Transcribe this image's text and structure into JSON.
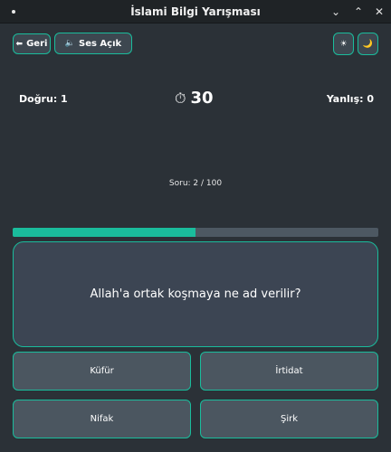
{
  "window": {
    "title": "İslami Bilgi Yarışması",
    "minimize_glyph": "⌄",
    "maximize_glyph": "⌃",
    "close_glyph": "✕"
  },
  "toolbar": {
    "back_icon": "⬅",
    "back_label": "Geri",
    "sound_icon": "🔈",
    "sound_label": "Ses Açık",
    "light_theme_icon": "☀",
    "dark_theme_icon": "🌙"
  },
  "stats": {
    "correct_label": "Doğru: 1",
    "wrong_label": "Yanlış: 0"
  },
  "timer": {
    "icon": "⏱",
    "seconds": "30"
  },
  "question_counter": "Soru: 2 / 100",
  "progress": {
    "fraction": 0.5
  },
  "question": {
    "text": "Allah'a ortak koşmaya ne ad verilir?"
  },
  "answers": [
    {
      "label": "Küfür"
    },
    {
      "label": "İrtidat"
    },
    {
      "label": "Nifak"
    },
    {
      "label": "Şirk"
    }
  ],
  "colors": {
    "accent": "#1abc9c",
    "background": "#2b3137",
    "card": "#3c4553",
    "answer_button": "#4b5660"
  }
}
